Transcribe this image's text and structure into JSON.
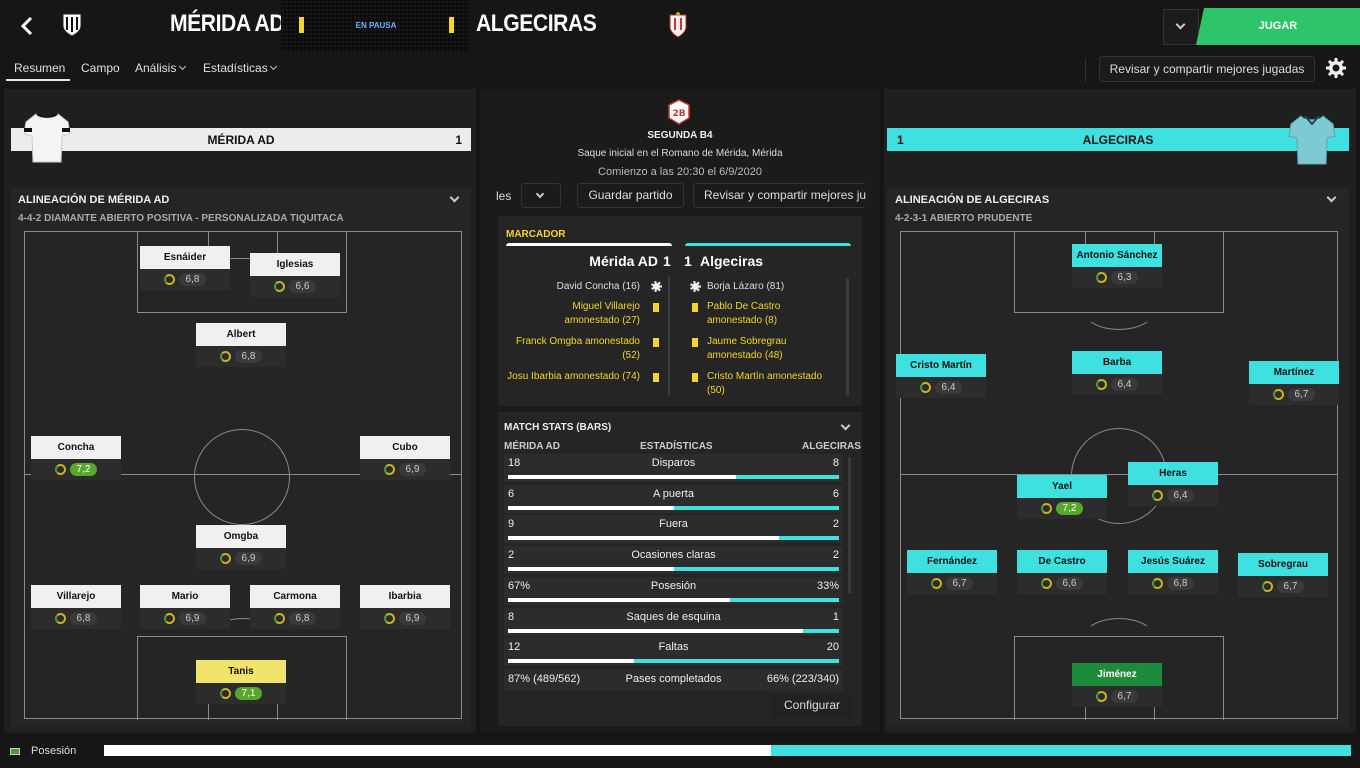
{
  "header": {
    "home_name": "MÉRIDA AD",
    "away_name": "ALGECIRAS",
    "status": "EN PAUSA",
    "play_label": "JUGAR",
    "back_icon": "back-arrow-icon"
  },
  "nav": {
    "tabs": [
      "Resumen",
      "Campo",
      "Análisis",
      "Estadísticas"
    ],
    "share_label": "Revisar y compartir mejores jugadas",
    "settings_icon": "gear-icon"
  },
  "home": {
    "name": "MÉRIDA AD",
    "score": "1",
    "lineup_title": "ALINEACIÓN DE MÉRIDA AD",
    "formation": "4-4-2 DIAMANTE ABIERTO POSITIVA - PERSONALIZADA TIQUITACA",
    "players": [
      {
        "name": "Esnáider",
        "rating": "6,8",
        "hl": false
      },
      {
        "name": "Iglesias",
        "rating": "6,6",
        "hl": false
      },
      {
        "name": "Albert",
        "rating": "6,8",
        "hl": false
      },
      {
        "name": "Concha",
        "rating": "7,2",
        "hl": true
      },
      {
        "name": "Cubo",
        "rating": "6,9",
        "hl": false
      },
      {
        "name": "Omgba",
        "rating": "6,9",
        "hl": false
      },
      {
        "name": "Villarejo",
        "rating": "6,8",
        "hl": false
      },
      {
        "name": "Mario",
        "rating": "6,9",
        "hl": false
      },
      {
        "name": "Carmona",
        "rating": "6,8",
        "hl": false
      },
      {
        "name": "Ibarbia",
        "rating": "6,9",
        "hl": false
      },
      {
        "name": "Tanis",
        "rating": "7,1",
        "hl": true
      }
    ]
  },
  "away": {
    "name": "ALGECIRAS",
    "score": "1",
    "lineup_title": "ALINEACIÓN DE ALGECIRAS",
    "formation": "4-2-3-1 ABIERTO PRUDENTE",
    "players": [
      {
        "name": "Antonio Sánchez",
        "rating": "6,3",
        "hl": false
      },
      {
        "name": "Cristo Martín",
        "rating": "6,4",
        "hl": false
      },
      {
        "name": "Barba",
        "rating": "6,4",
        "hl": false
      },
      {
        "name": "Martínez",
        "rating": "6,7",
        "hl": false
      },
      {
        "name": "Heras",
        "rating": "6,4",
        "hl": false
      },
      {
        "name": "Yael",
        "rating": "7,2",
        "hl": true
      },
      {
        "name": "Fernández",
        "rating": "6,7",
        "hl": false
      },
      {
        "name": "De Castro",
        "rating": "6,6",
        "hl": false
      },
      {
        "name": "Jesús Suárez",
        "rating": "6,8",
        "hl": false
      },
      {
        "name": "Sobregrau",
        "rating": "6,7",
        "hl": false
      },
      {
        "name": "Jiménez",
        "rating": "6,7",
        "hl": false
      }
    ]
  },
  "match": {
    "competition": "SEGUNDA B4",
    "venue": "Saque inicial en el Romano de Mérida, Mérida",
    "kickoff": "Comienzo a las 20:30 el 6/9/2020",
    "left_tab": "les",
    "save_label": "Guardar partido",
    "share_label": "Revisar y compartir mejores ju"
  },
  "scoreboard": {
    "title": "MARCADOR",
    "home": "Mérida AD",
    "home_score": "1",
    "away_score": "1",
    "away": "Algeciras",
    "home_events": [
      "David Concha (16)",
      "Miguel Villarejo amonestado (27)",
      "Franck Omgba amonestado (52)",
      "Josu Ibarbia amonestado (74)"
    ],
    "away_events": [
      "Borja Lázaro (81)",
      "Pablo De Castro amonestado (8)",
      "Jaume Sobregrau amonestado (48)",
      "Cristo Martín amonestado (50)"
    ]
  },
  "stats": {
    "title": "MATCH STATS (BARS)",
    "col_home": "MÉRIDA AD",
    "col_mid": "ESTADÍSTICAS",
    "col_away": "ALGECIRAS",
    "rows": [
      {
        "label": "Disparos",
        "home": "18",
        "away": "8",
        "home_share": 0.69
      },
      {
        "label": "A puerta",
        "home": "6",
        "away": "6",
        "home_share": 0.5
      },
      {
        "label": "Fuera",
        "home": "9",
        "away": "2",
        "home_share": 0.82
      },
      {
        "label": "Ocasiones claras",
        "home": "2",
        "away": "2",
        "home_share": 0.5
      },
      {
        "label": "Posesión",
        "home": "67%",
        "away": "33%",
        "home_share": 0.67
      },
      {
        "label": "Saques de esquina",
        "home": "8",
        "away": "1",
        "home_share": 0.89
      },
      {
        "label": "Faltas",
        "home": "12",
        "away": "20",
        "home_share": 0.38
      }
    ],
    "passes": {
      "label": "Pases completados",
      "home": "87% (489/562)",
      "away": "66% (223/340)"
    },
    "configure_label": "Configurar"
  },
  "footer": {
    "label": "Posesión",
    "home_share": 0.535
  },
  "colors": {
    "home": "#ffffff",
    "away": "#3ee0e0",
    "highlight": "#f5d52a",
    "rating_good": "#58a82c",
    "keeper_away": "#1e8a3c"
  }
}
